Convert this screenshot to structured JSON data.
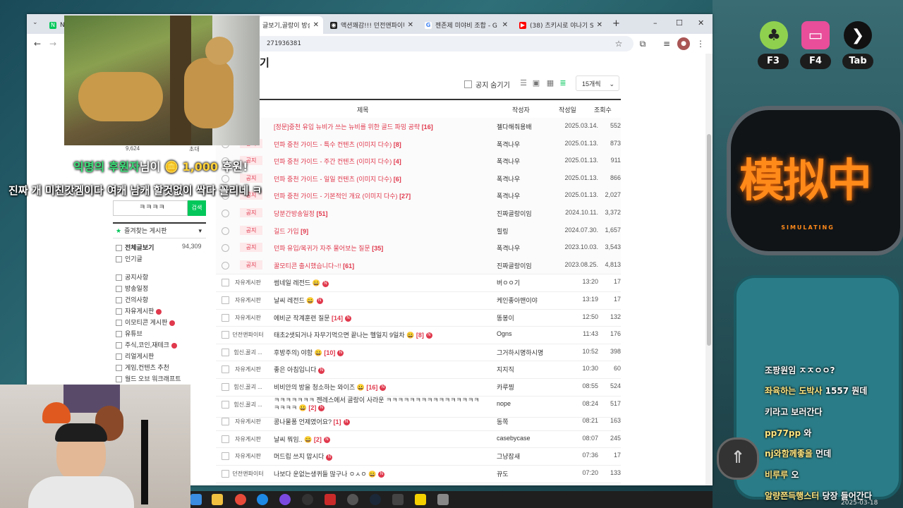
{
  "browser": {
    "tabs": [
      {
        "label": "N",
        "active": false
      },
      {
        "label": "글보기,골랑이 방송",
        "active": true
      },
      {
        "label": "액션꽤감!!! 던전앤파이터",
        "active": false
      },
      {
        "label": "젠존제 미야비 조합 - G",
        "active": false
      },
      {
        "label": "(38) 츠키시로 야나기 S",
        "active": false
      }
    ],
    "new_tab": "+",
    "url": "271936381",
    "window_controls": {
      "minimize": "–",
      "maximize": "☐",
      "close": "✕"
    }
  },
  "board": {
    "heading_fragment": "기",
    "hide_notice_label": "공지 숨기기",
    "per_page": "15개씩",
    "columns": {
      "title": "제목",
      "author": "작성자",
      "date": "작성일",
      "views": "조회수"
    },
    "rows": [
      {
        "type": "notice",
        "badge": "",
        "title": "[정문]중천 유입 뉴비가 쓰는 뉴비를 위한 골드 파밍 공략",
        "count": "[16]",
        "author": "젤다해줘용배",
        "date": "2025.03.14.",
        "views": "552"
      },
      {
        "type": "notice",
        "badge": "공지",
        "title": "던파 중천 가이드 - 특수 컨텐츠 (이미지 다수)",
        "count": "[8]",
        "author": "폭격나우",
        "date": "2025.01.13.",
        "views": "873"
      },
      {
        "type": "notice",
        "badge": "공지",
        "title": "던파 중천 가이드 - 주간 컨텐츠 (이미지 다수)",
        "count": "[4]",
        "author": "폭격나우",
        "date": "2025.01.13.",
        "views": "911"
      },
      {
        "type": "notice",
        "badge": "공지",
        "title": "던파 중천 가이드 - 일일 컨텐츠 (이미지 다수)",
        "count": "[6]",
        "author": "폭격나우",
        "date": "2025.01.13.",
        "views": "866"
      },
      {
        "type": "notice",
        "badge": "공지",
        "title": "던파 중천 가이드 - 기본적인 개요 (이미지 다수)",
        "count": "[27]",
        "author": "폭격나우",
        "date": "2025.01.13.",
        "views": "2,027"
      },
      {
        "type": "notice",
        "badge": "공지",
        "title": "당분간방송일정",
        "count": "[51]",
        "author": "진짜골랑이임",
        "date": "2024.10.11.",
        "views": "3,372"
      },
      {
        "type": "notice",
        "badge": "공지",
        "title": "길드 가입",
        "count": "[9]",
        "author": "힐링",
        "date": "2024.07.30.",
        "views": "1,657"
      },
      {
        "type": "notice",
        "badge": "공지",
        "title": "던파 유입/복귀가 자주 물어보는 질문",
        "count": "[35]",
        "author": "폭격나우",
        "date": "2023.10.03.",
        "views": "3,543"
      },
      {
        "type": "notice",
        "badge": "공지",
        "title": "꿀모티콘 출시했습니다~!!",
        "count": "[61]",
        "author": "진짜골랑이임",
        "date": "2023.08.25.",
        "views": "4,813"
      },
      {
        "type": "normal",
        "cat": "자유게시판",
        "title": "썸네일 레전드 😀",
        "count": "",
        "new": true,
        "author": "버ㅇㅇ기",
        "date": "13:20",
        "views": "17"
      },
      {
        "type": "normal",
        "cat": "자유게시판",
        "title": "날씨 레전드 😀",
        "count": "",
        "new": true,
        "author": "케인좋아맨이야",
        "date": "13:19",
        "views": "17"
      },
      {
        "type": "normal",
        "cat": "자유게시판",
        "title": "에비군 작계훈련 질문",
        "count": "[14]",
        "new": true,
        "author": "똥봉이",
        "date": "12:50",
        "views": "132"
      },
      {
        "type": "normal",
        "cat": "던전앤파이터",
        "title": "태초2샛되거나 자무기먹으면 끝나는 헬일지 9일차 😀",
        "count": "[8]",
        "new": true,
        "author": "Ogns",
        "date": "11:43",
        "views": "176"
      },
      {
        "type": "normal",
        "cat": "힘신,꿀괴 ...",
        "title": "후방주의) 야함 😀",
        "count": "[10]",
        "new": true,
        "author": "그거하시명하시명",
        "date": "10:52",
        "views": "398"
      },
      {
        "type": "normal",
        "cat": "자유게시판",
        "title": "좋은 아침입니다",
        "count": "",
        "new": true,
        "author": "지지직",
        "date": "10:30",
        "views": "60"
      },
      {
        "type": "normal",
        "cat": "힘신,꿀괴 ...",
        "title": "비비안의 방을 청소하는 와이즈 😀",
        "count": "[16]",
        "new": true,
        "author": "카루찡",
        "date": "08:55",
        "views": "524"
      },
      {
        "type": "normal",
        "cat": "힘신,꿀괴 ...",
        "title": "ㅋㅋㅋㅋㅋㅋㅋ 젠레스에서 골랑이 사라운 ㅋㅋㅋㅋㅋㅋㅋㅋㅋㅋㅋㅋㅋㅋㅋㅋ",
        "title2": "ㅋㅋㅋㅋ 😀",
        "count": "[2]",
        "new": true,
        "author": "nope",
        "date": "08:24",
        "views": "517"
      },
      {
        "type": "normal",
        "cat": "자유게시판",
        "title": "콩나물퐁 언제였어요?",
        "count": "[1]",
        "new": true,
        "author": "동쪽",
        "date": "08:21",
        "views": "163"
      },
      {
        "type": "normal",
        "cat": "자유게시판",
        "title": "날씨 뭐임.. 😀",
        "count": "[2]",
        "new": true,
        "author": "casebycase",
        "date": "08:07",
        "views": "245"
      },
      {
        "type": "normal",
        "cat": "자유게시판",
        "title": "머드립 쓰지 맙시다",
        "count": "",
        "new": true,
        "author": "그냥잠새",
        "date": "07:36",
        "views": "17"
      },
      {
        "type": "normal",
        "cat": "던전앤파이터",
        "title": "나보다 운없는생퀴들 많구나 ㅇㅅㅇ 😀",
        "count": "",
        "new": true,
        "author": "뀨도",
        "date": "07:20",
        "views": "133"
      }
    ]
  },
  "sidebar": {
    "member_count": "9,624",
    "member_label": "초대",
    "search_value": "ㅋㅋㅋㅋ",
    "search_button": "검색",
    "favorites_label": "즐겨찾는 게시판",
    "items": [
      {
        "label": "전체글보기",
        "count": "94,309",
        "bold": true,
        "new": false
      },
      {
        "label": "인기글",
        "count": "",
        "bold": false,
        "new": false
      },
      {
        "label": "공지사항",
        "count": "",
        "bold": false,
        "new": false
      },
      {
        "label": "방송일정",
        "count": "",
        "bold": false,
        "new": false
      },
      {
        "label": "건의사항",
        "count": "",
        "bold": false,
        "new": false
      },
      {
        "label": "자유게시판",
        "count": "",
        "bold": false,
        "new": true
      },
      {
        "label": "이모티콘 게시판",
        "count": "",
        "bold": false,
        "new": true
      },
      {
        "label": "유튜브",
        "count": "",
        "bold": false,
        "new": false
      },
      {
        "label": "주식,코인,재테크",
        "count": "",
        "bold": false,
        "new": true
      },
      {
        "label": "리얼게시판",
        "count": "",
        "bold": false,
        "new": false
      },
      {
        "label": "게임,컨텐츠 추천",
        "count": "",
        "bold": false,
        "new": false
      },
      {
        "label": "월드 오브 워크래프트",
        "count": "",
        "bold": false,
        "new": false
      }
    ]
  },
  "overlay": {
    "donor": "익명의",
    "donor_role": "후원자",
    "donation_mid": "님이",
    "amount": "1,000",
    "donation_suffix": "후원!",
    "message": "진짜 개 미친갓겜이다 여캐 남캐 할것없이 싹다 꼴리네 ㅋ"
  },
  "hud": {
    "keys": [
      "F3",
      "F4",
      "Tab"
    ],
    "sign_text": "模拟中",
    "sign_sub": "SIMULATING"
  },
  "chat": [
    {
      "user": "",
      "text": "조팡원임 ㅈㅈㅇㅇ?"
    },
    {
      "user": "좌육하는 도박사",
      "text": "1557 뭔데"
    },
    {
      "user": "",
      "text": "키라고 보러간다"
    },
    {
      "user": "pp77pp",
      "text": "와"
    },
    {
      "user": "nj와함께좋을",
      "text": "먼데"
    },
    {
      "user": "비루루",
      "text": "오"
    },
    {
      "user": "알량쯘득행스터",
      "text": "당장 들어간다"
    }
  ],
  "clock": "2025-03-18",
  "colors": {
    "accent_red": "#e0384c",
    "naver_green": "#03c75a",
    "donation_green": "#3de07a"
  }
}
